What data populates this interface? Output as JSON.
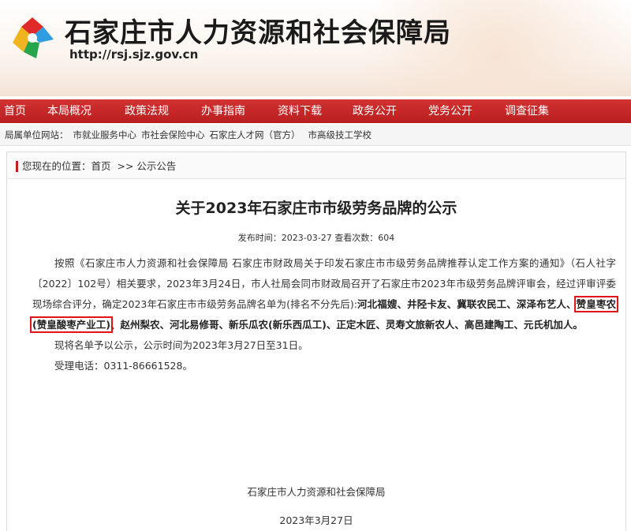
{
  "site": {
    "title": "石家庄市人力资源和社会保障局",
    "url": "http://rsj.sjz.gov.cn"
  },
  "nav": [
    {
      "label": "首页",
      "w": 38
    },
    {
      "label": "本局概况",
      "w": 100
    },
    {
      "label": "政策法规",
      "w": 96
    },
    {
      "label": "办事指南",
      "w": 98
    },
    {
      "label": "资料下载",
      "w": 96
    },
    {
      "label": "政务公开",
      "w": 94
    },
    {
      "label": "党务公开",
      "w": 98
    },
    {
      "label": "调查征集",
      "w": 96
    }
  ],
  "subbar": {
    "label": "局属单位网站：",
    "links": [
      "市就业服务中心",
      "市社会保险中心",
      "石家庄人才网（官方）",
      "市高级技工学校"
    ]
  },
  "breadcrumb": {
    "prefix": "您现在的位置：",
    "home": "首页",
    "sep": ">>",
    "current": "公示公告"
  },
  "article": {
    "title": "关于2023年石家庄市市级劳务品牌的公示",
    "meta": "发布时间：2023-03-27  查看次数：604",
    "p1_text": "按照《石家庄市人力资源和社会保障局 石家庄市财政局关于印发石家庄市市级劳务品牌推荐认定工作方案的通知》（石人社字〔2022〕102号）相关要求，2023年3月24日，市人社局会同市财政局召开了石家庄市2023年市级劳务品牌评审会，经过评审评委现场综合评分，确定2023年石家庄市市级劳务品牌名单为(排名不分先后):",
    "p1_list_a": "河北福嫂、井陉卡友、冀联农民工、深泽布艺人、",
    "p1_highlight": "赞皇枣农(赞皇酸枣产业工)",
    "p1_list_b": "、赵州梨农、河北易修哥、新乐瓜农(新乐西瓜工)、正定木匠、灵寿文旅新农人、高邑建陶工、元氏机加人。",
    "p2": "现将名单予以公示，公示时间为2023年3月27日至31日。",
    "p3": "受理电话：0311-86661528。",
    "signature": "石家庄市人力资源和社会保障局",
    "date": "2023年3月27日"
  },
  "colors": {
    "nav_red": "#c21f1f",
    "highlight_border": "#e0141a"
  }
}
